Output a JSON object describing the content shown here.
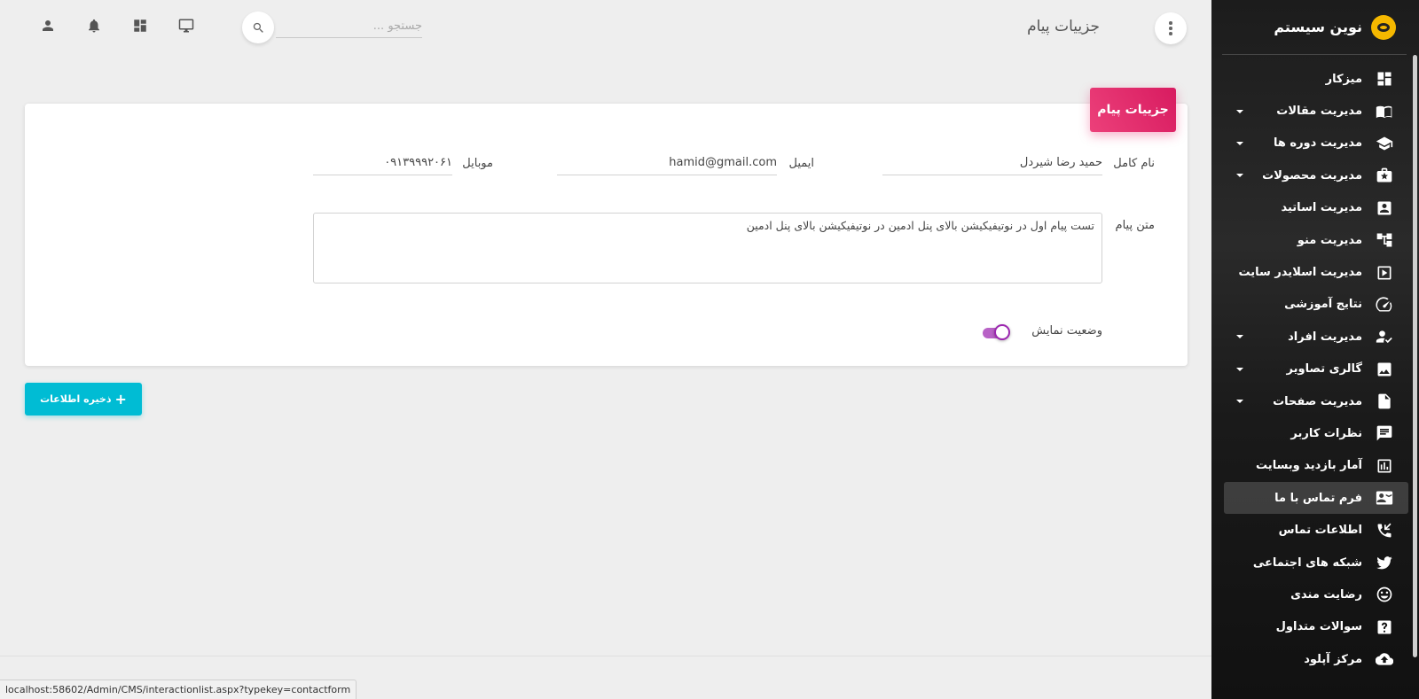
{
  "sidebar": {
    "brand": "نوین سیستم",
    "items": [
      {
        "label": "میزکار",
        "icon": "dashboard-icon",
        "caret": false
      },
      {
        "label": "مدیریت مقالات",
        "icon": "book-open-icon",
        "caret": true
      },
      {
        "label": "مدیریت دوره ها",
        "icon": "graduation-cap-icon",
        "caret": true
      },
      {
        "label": "مدیریت محصولات",
        "icon": "product-star-icon",
        "caret": true
      },
      {
        "label": "مدیریت اساتید",
        "icon": "contact-card-icon",
        "caret": false
      },
      {
        "label": "مدیریت منو",
        "icon": "menu-tree-icon",
        "caret": false
      },
      {
        "label": "مدیریت اسلایدر سایت",
        "icon": "slider-play-icon",
        "caret": false
      },
      {
        "label": "نتایج آموزشی",
        "icon": "speedometer-icon",
        "caret": false
      },
      {
        "label": "مدیریت افراد",
        "icon": "person-check-icon",
        "caret": true
      },
      {
        "label": "گالری تصاویر",
        "icon": "image-icon",
        "caret": true
      },
      {
        "label": "مدیریت صفحات",
        "icon": "page-icon",
        "caret": true
      },
      {
        "label": "نظرات کاربر",
        "icon": "comment-icon",
        "caret": false
      },
      {
        "label": "آمار بازدید وبسایت",
        "icon": "bar-chart-icon",
        "caret": false
      },
      {
        "label": "فرم تماس با ما",
        "icon": "contact-mail-icon",
        "caret": false,
        "active": true
      },
      {
        "label": "اطلاعات تماس",
        "icon": "phone-callback-icon",
        "caret": false
      },
      {
        "label": "شبکه های اجتماعی",
        "icon": "twitter-icon",
        "caret": false
      },
      {
        "label": "رضایت مندی",
        "icon": "smiley-icon",
        "caret": false
      },
      {
        "label": "سوالات متداول",
        "icon": "help-box-icon",
        "caret": false
      },
      {
        "label": "مرکز آپلود",
        "icon": "cloud-upload-icon",
        "caret": false
      }
    ]
  },
  "header": {
    "title": "جزییات پیام",
    "search_placeholder": "جستجو ..."
  },
  "card": {
    "title": "جزییات پیام",
    "fullname_label": "نام کامل",
    "fullname_value": "حمید رضا شیردل",
    "email_label": "ایمیل",
    "email_value": "hamid@gmail.com",
    "mobile_label": "موبایل",
    "mobile_value": "۰۹۱۳۹۹۹۲۰۶۱",
    "message_label": "متن پیام",
    "message_value": "تست پیام اول در نوتیفیکیشن بالای پنل ادمین در نوتیفیکیشن بالای پنل ادمین",
    "status_label": "وضعیت نمایش",
    "status_on": true
  },
  "actions": {
    "save_label": "ذخیره اطلاعات"
  },
  "status_bar": {
    "url": "localhost:58602/Admin/CMS/interactionlist.aspx?typekey=contactform"
  },
  "colors": {
    "accent_pink": "#e91e63",
    "accent_cyan": "#00bcd4",
    "toggle_purple": "#9c27b0",
    "logo_yellow": "#f5b800"
  }
}
